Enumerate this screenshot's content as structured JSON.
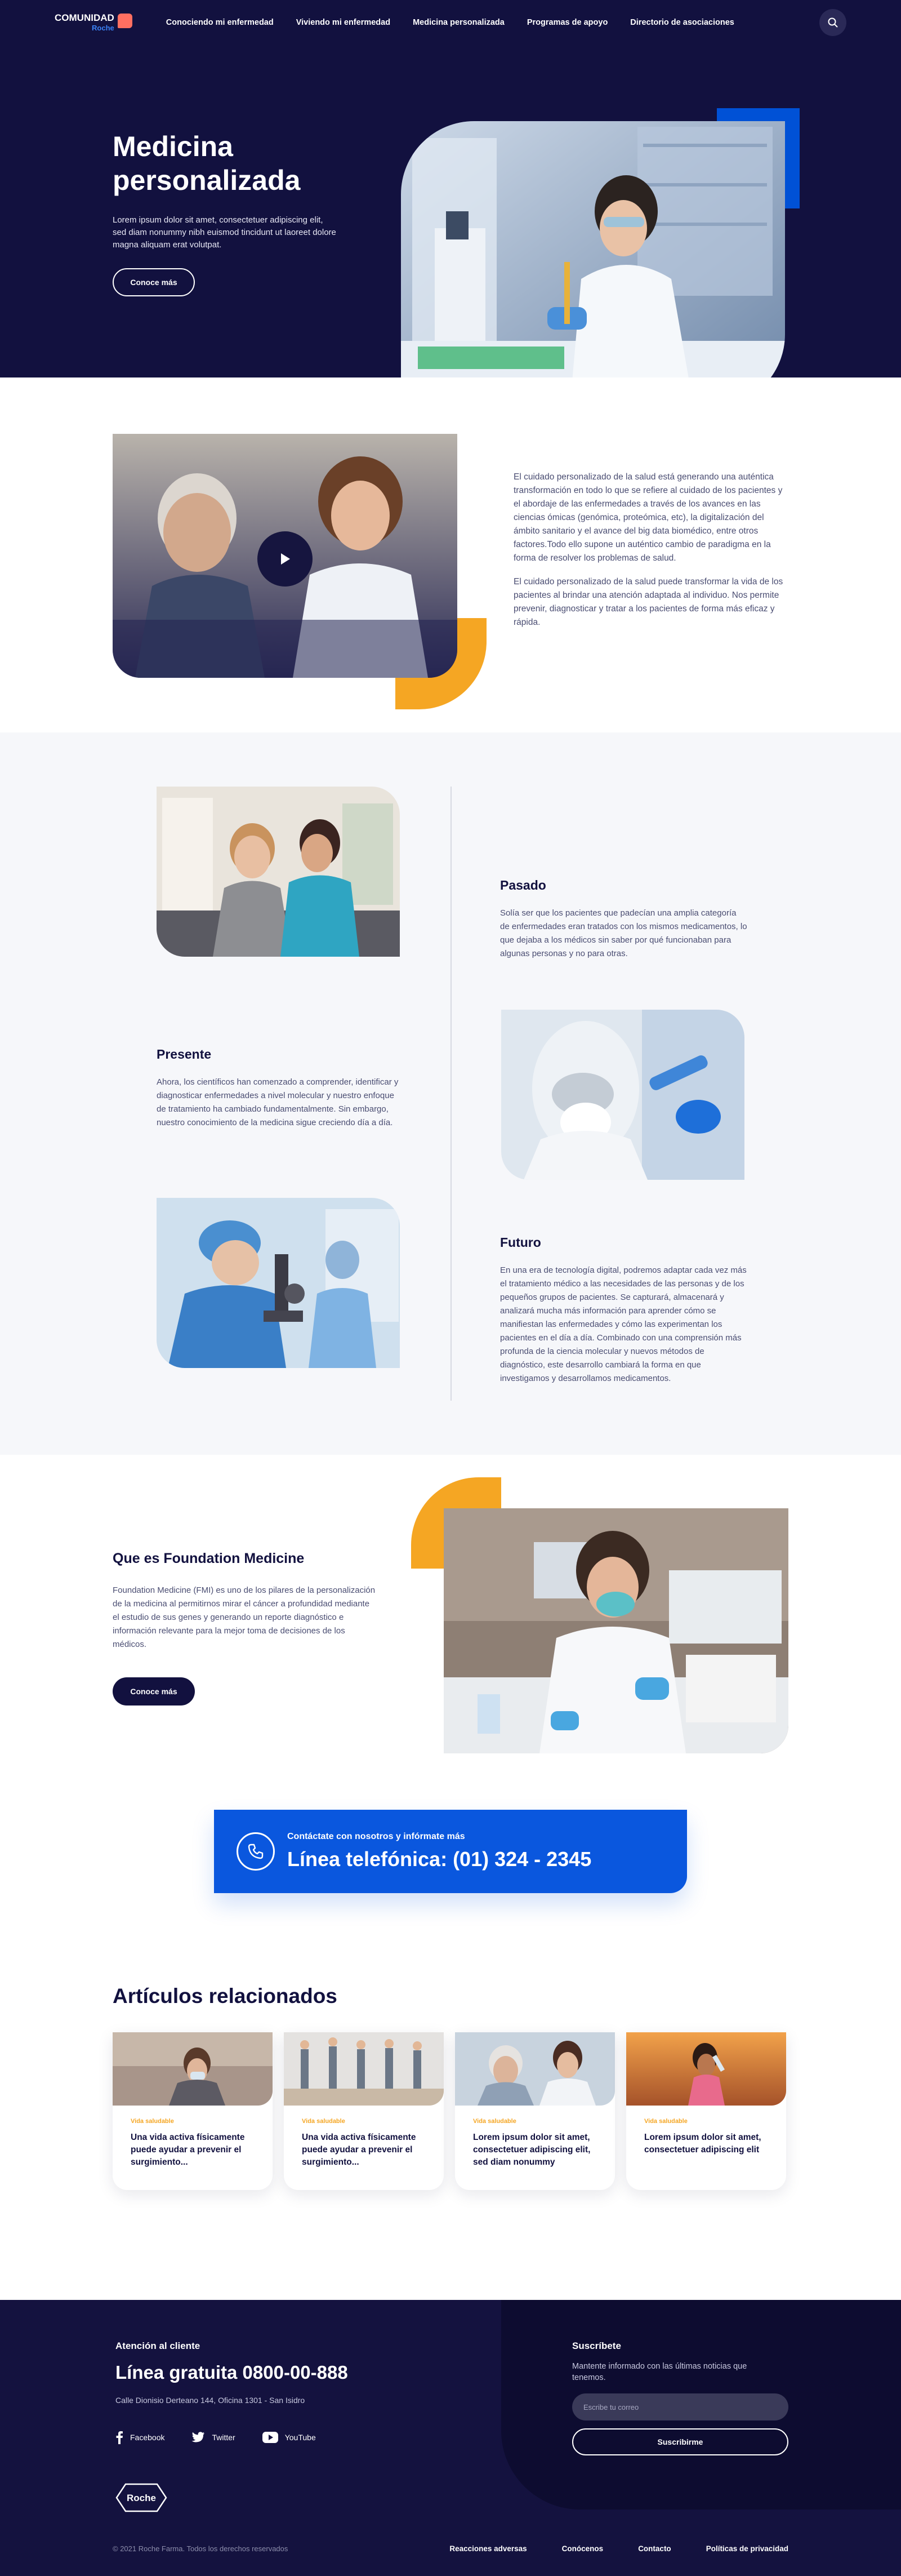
{
  "brand": {
    "name": "COMUNIDAD",
    "sub": "Roche"
  },
  "nav": {
    "links": [
      "Conociendo mi enfermedad",
      "Viviendo mi enfermedad",
      "Medicina personalizada",
      "Programas de apoyo",
      "Directorio de asociaciones"
    ],
    "search_icon": "search-icon"
  },
  "hero": {
    "title": "Medicina personalizada",
    "text": "Lorem ipsum dolor sit amet, consectetuer adipiscing elit, sed diam nonummy nibh euismod tincidunt ut laoreet dolore magna aliquam erat volutpat.",
    "button": "Conoce más"
  },
  "video": {
    "p1": " El cuidado personalizado de la salud está generando una auténtica transformación en todo lo que se refiere al cuidado de los pacientes  y el abordaje de las enfermedades a través de los avances en las ciencias ómicas (genómica, proteómica, etc), la digitalización del ámbito sanitario y el avance del big data biomédico, entre otros factores.Todo ello supone un auténtico cambio de paradigma en la forma de resolver los problemas de salud.",
    "p2": "El cuidado personalizado de la salud puede transformar la vida de los pacientes al brindar una atención adaptada al individuo. Nos permite prevenir, diagnosticar y tratar a los pacientes de forma más eficaz y rápida."
  },
  "timeline": [
    {
      "title": "Pasado",
      "text": "Solía ser que los pacientes que padecían una amplia categoría de enfermedades eran tratados con los mismos medicamentos, lo que dejaba a los médicos sin saber por qué funcionaban para algunas personas y no para otras."
    },
    {
      "title": "Presente",
      "text": "Ahora, los científicos han comenzado a comprender, identificar y diagnosticar enfermedades a nivel molecular y nuestro enfoque de tratamiento ha cambiado fundamentalmente. Sin embargo, nuestro conocimiento de la medicina sigue creciendo día a día."
    },
    {
      "title": "Futuro",
      "text": "En una era de tecnología digital, podremos adaptar cada vez más el tratamiento médico a las necesidades de las personas y de los pequeños grupos de pacientes. Se capturará, almacenará y analizará mucha más información para aprender cómo se manifiestan las enfermedades y cómo las experimentan los pacientes en el día a día. Combinado con una comprensión más profunda de la ciencia molecular y nuevos métodos de diagnóstico, este desarrollo cambiará la forma en que investigamos y desarrollamos medicamentos."
    }
  ],
  "foundation": {
    "title": "Que es Foundation Medicine",
    "text": "Foundation Medicine (FMI) es uno de los pilares de la personalización de la medicina al permitirnos mirar el cáncer a profundidad mediante el estudio de sus genes y generando un reporte diagnóstico e información relevante para la mejor toma de decisiones de los médicos.",
    "button": "Conoce más"
  },
  "contact": {
    "small": "Contáctate con nosotros y infórmate más",
    "big": "Línea telefónica: (01) 324 - 2345"
  },
  "articles": {
    "title": "Artículos relacionados",
    "items": [
      {
        "tag": "Vida saludable",
        "title": "Una vida activa físicamente puede ayudar a prevenir el surgimiento..."
      },
      {
        "tag": "Vida saludable",
        "title": "Una vida activa físicamente puede ayudar a prevenir el surgimiento..."
      },
      {
        "tag": "Vida saludable",
        "title": "Lorem ipsum dolor sit amet, consectetuer adipiscing elit, sed diam nonummy"
      },
      {
        "tag": "Vida saludable",
        "title": "Lorem ipsum dolor sit amet, consectetuer adipiscing elit"
      }
    ]
  },
  "footer": {
    "attention": "Atención al cliente",
    "phone": "Línea gratuita 0800-00-888",
    "address": "Calle Dionisio Derteano 144, Oficina 1301 - San Isidro",
    "socials": [
      "Facebook",
      "Twitter",
      "YouTube"
    ],
    "roche": "Roche",
    "subscribe_title": "Suscríbete",
    "subscribe_text": "Mantente informado con las últimas noticias que tenemos.",
    "input_placeholder": "Escribe tu correo",
    "subscribe_button": "Suscribirme",
    "copyright": "© 2021 Roche Farma. Todos los derechos reservados",
    "links": [
      "Reacciones adversas",
      "Conócenos",
      "Contacto",
      "Políticas de privacidad"
    ]
  },
  "colors": {
    "navy": "#12113f",
    "blue": "#0a57de",
    "orange": "#f5a623"
  }
}
